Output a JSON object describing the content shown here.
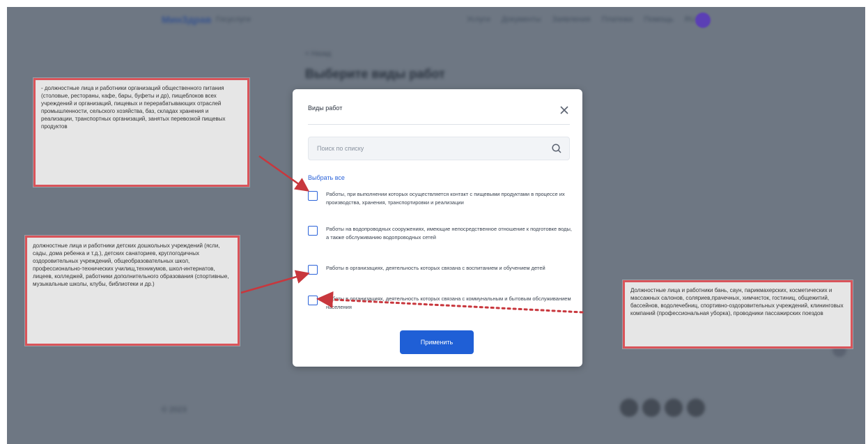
{
  "modal": {
    "title": "Виды работ",
    "search_placeholder": "Поиск по списку",
    "select_all": "Выбрать все",
    "options": [
      {
        "label": "Работы, при выполнении которых осуществляется контакт с пищевыми продуктами в процессе их производства, хранения, транспортировки и реализации",
        "checked": false
      },
      {
        "label": "Работы на водопроводных сооружениях, имеющие непосредственное отношение к подготовке воды, а также обслуживанию водопроводных сетей",
        "checked": false
      },
      {
        "label": "Работы в организациях, деятельность которых связана с воспитанием и обучением детей",
        "checked": false
      },
      {
        "label": "Работы в организациях, деятельность которых связана с коммунальным и бытовым обслуживанием населения",
        "checked": false
      }
    ],
    "apply_label": "Применить"
  },
  "callouts": {
    "top_left": "- должностные лица и работники организаций общественного питания (столовые, рестораны, кафе, бары, буфеты и др), пищеблоков всех учреждений и организаций, пищевых и перерабатывающих отраслей промышленности, сельского хозяйства, баз, складах хранения и реализации, транспортных организаций, занятых перевозкой пищевых продуктов",
    "bottom_left": "должностные лица и работники детских дошкольных учреждений (ясли, сады, дома ребенка и т.д.), детских санаториев, круглогодичных оздоровительных учреждений, общеобразовательных школ, профессионально-технических училищ,техникумов, школ-интернатов, лицеев, колледжей, работники дополнительного образования (спортивные, музыкальные школы, клубы, библиотеки и др.)",
    "right": "Должностные лица и работники бань, саун, парикмахерских, косметических и массажных салонов, соляриев,прачечных, химчисток, гостиниц, общежитий, бассейнов, водолечебниц, спортивно-оздоровительных учреждений, клининговых компаний (профессиональная уборка), проводники пассажирских поездов"
  },
  "background": {
    "logo": "МинЗдрав",
    "logo_sub": "Госуслуги",
    "nav": [
      "Услуги",
      "Документы",
      "Заявления",
      "Платежи",
      "Помощь",
      "RU"
    ],
    "breadcrumb": "< Назад",
    "page_title": "Выберите виды работ",
    "footer": "© 2023"
  },
  "colors": {
    "overlay": "#6e7783",
    "accent": "#1f5fd6",
    "callout_border": "#d9545a",
    "arrow": "#c8373d"
  }
}
